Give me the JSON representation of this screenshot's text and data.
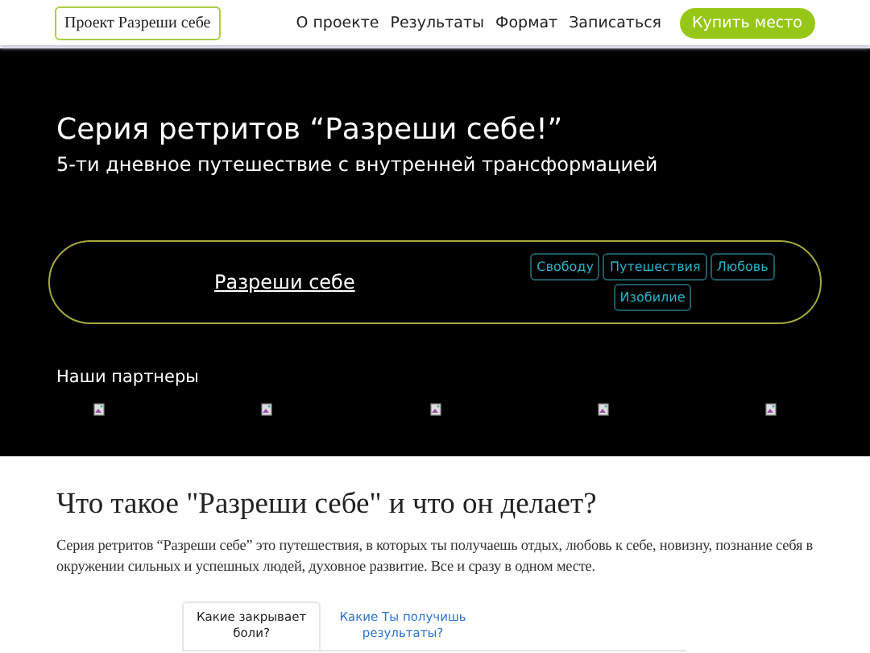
{
  "header": {
    "logo": "Проект Разреши себе",
    "nav": [
      "О проекте",
      "Результаты",
      "Формат",
      "Записаться"
    ],
    "cta": "Купить место"
  },
  "hero": {
    "title": "Серия ретритов “Разреши себе!”",
    "subtitle": "5-ти дневное путешествие с внутренней трансформацией",
    "banner": {
      "link": "Разреши себе",
      "tags": [
        "Свободу",
        "Путешествия",
        "Любовь",
        "Изобилие"
      ]
    },
    "partners_title": "Наши партнеры",
    "partners": [
      {
        "kind": "broken-image"
      },
      {
        "kind": "broken-image"
      },
      {
        "kind": "broken-image"
      },
      {
        "kind": "broken-image"
      },
      {
        "kind": "broken-image"
      }
    ]
  },
  "about": {
    "title": "Что такое \"Разреши себе\" и что он делает?",
    "text": "Серия ретритов “Разреши себе” это путешествия, в которых ты получаешь отдых, любовь к себе, новизну, познание себя в окружении сильных и успешных людей, духовное развитие. Все и сразу в одном месте.",
    "tabs": [
      {
        "label": "Какие закрывает боли?",
        "selected": true
      },
      {
        "label": "Какие Ты получишь результаты?",
        "selected": false
      }
    ]
  }
}
